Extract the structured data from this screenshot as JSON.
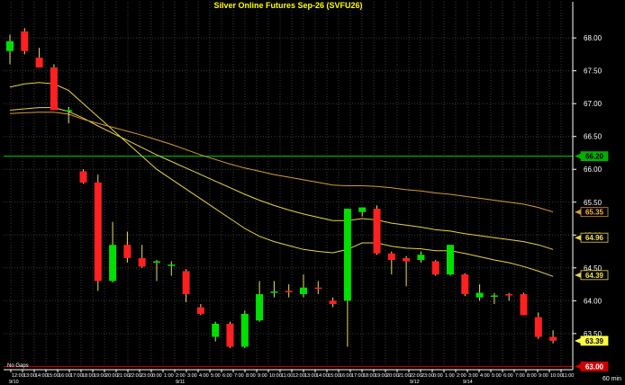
{
  "chart_data": {
    "type": "candlestick",
    "title": "Silver Online Futures  Sep-26  (SVFU26)",
    "interval_label": "60  min",
    "footnote": "No Gaps",
    "ylim": [
      62.95,
      68.55
    ],
    "y_ticks": [
      63.5,
      64.0,
      64.5,
      65.0,
      65.5,
      66.0,
      66.5,
      67.0,
      67.5,
      68.0
    ],
    "y_tick_labels": [
      "63.50",
      "64.00",
      "64.50",
      "65.00",
      "65.50",
      "66.00",
      "66.50",
      "67.00",
      "67.50",
      "68.00"
    ],
    "x_tick_labels": [
      "12:00",
      "13:00",
      "14:00",
      "15:00",
      "16:00",
      "17:00",
      "18:00",
      "19:00",
      "20:00",
      "21:00",
      "22:00",
      "23:00",
      "0:00",
      "1:00",
      "2:00",
      "3:00",
      "4:00",
      "5:00",
      "6:00",
      "7:00",
      "8:00",
      "9:00",
      "10:00",
      "11:00",
      "12:00",
      "13:00",
      "14:00",
      "15:00",
      "16:00",
      "17:00",
      "18:00",
      "19:00",
      "20:00",
      "21:00",
      "22:00",
      "23:00",
      "0:00",
      "1:00",
      "2:00",
      "3:00",
      "4:00",
      "5:00",
      "6:00",
      "7:00",
      "8:00",
      "9:00",
      "10:00",
      "11:00"
    ],
    "date_labels": [
      "9/10",
      "9/11",
      "9/12",
      "9/14"
    ],
    "candles": [
      {
        "o": 67.8,
        "h": 68.05,
        "l": 67.6,
        "c": 67.95
      },
      {
        "o": 68.1,
        "h": 68.15,
        "l": 67.75,
        "c": 67.8
      },
      {
        "o": 67.7,
        "h": 67.85,
        "l": 67.55,
        "c": 67.55
      },
      {
        "o": 67.55,
        "h": 67.6,
        "l": 66.9,
        "c": 66.9
      },
      {
        "o": 66.9,
        "h": 66.95,
        "l": 66.7,
        "c": 66.9
      },
      {
        "o": 65.97,
        "h": 66.0,
        "l": 65.78,
        "c": 65.8
      },
      {
        "o": 65.8,
        "h": 65.92,
        "l": 64.15,
        "c": 64.3
      },
      {
        "o": 64.3,
        "h": 65.2,
        "l": 64.28,
        "c": 64.85
      },
      {
        "o": 64.85,
        "h": 65.05,
        "l": 64.58,
        "c": 64.65
      },
      {
        "o": 64.65,
        "h": 64.85,
        "l": 64.5,
        "c": 64.52
      },
      {
        "o": 64.58,
        "h": 64.62,
        "l": 64.3,
        "c": 64.6
      },
      {
        "o": 64.55,
        "h": 64.6,
        "l": 64.38,
        "c": 64.55
      },
      {
        "o": 64.45,
        "h": 64.48,
        "l": 63.98,
        "c": 64.1
      },
      {
        "o": 63.9,
        "h": 63.95,
        "l": 63.78,
        "c": 63.8
      },
      {
        "o": 63.45,
        "h": 63.68,
        "l": 63.38,
        "c": 63.65
      },
      {
        "o": 63.65,
        "h": 63.68,
        "l": 63.28,
        "c": 63.3
      },
      {
        "o": 63.3,
        "h": 63.85,
        "l": 63.28,
        "c": 63.8
      },
      {
        "o": 63.7,
        "h": 64.3,
        "l": 63.68,
        "c": 64.1
      },
      {
        "o": 64.12,
        "h": 64.3,
        "l": 64.05,
        "c": 64.14
      },
      {
        "o": 64.15,
        "h": 64.25,
        "l": 64.05,
        "c": 64.13
      },
      {
        "o": 64.1,
        "h": 64.4,
        "l": 64.05,
        "c": 64.2
      },
      {
        "o": 64.2,
        "h": 64.3,
        "l": 64.1,
        "c": 64.18
      },
      {
        "o": 64.0,
        "h": 64.05,
        "l": 63.9,
        "c": 63.95
      },
      {
        "o": 64.0,
        "h": 65.4,
        "l": 63.3,
        "c": 65.4
      },
      {
        "o": 65.35,
        "h": 65.42,
        "l": 65.28,
        "c": 65.42
      },
      {
        "o": 65.4,
        "h": 65.45,
        "l": 64.7,
        "c": 64.72
      },
      {
        "o": 64.72,
        "h": 64.75,
        "l": 64.4,
        "c": 64.62
      },
      {
        "o": 64.65,
        "h": 64.68,
        "l": 64.22,
        "c": 64.6
      },
      {
        "o": 64.62,
        "h": 64.75,
        "l": 64.58,
        "c": 64.7
      },
      {
        "o": 64.6,
        "h": 64.62,
        "l": 64.38,
        "c": 64.4
      },
      {
        "o": 64.4,
        "h": 64.85,
        "l": 64.38,
        "c": 64.85
      },
      {
        "o": 64.4,
        "h": 64.42,
        "l": 64.07,
        "c": 64.1
      },
      {
        "o": 64.05,
        "h": 64.25,
        "l": 64.0,
        "c": 64.12
      },
      {
        "o": 64.08,
        "h": 64.12,
        "l": 63.95,
        "c": 64.08
      },
      {
        "o": 64.1,
        "h": 64.12,
        "l": 64.0,
        "c": 64.08
      },
      {
        "o": 64.1,
        "h": 64.12,
        "l": 63.8,
        "c": 63.78
      },
      {
        "o": 63.75,
        "h": 63.82,
        "l": 63.42,
        "c": 63.45
      },
      {
        "o": 63.45,
        "h": 63.55,
        "l": 63.35,
        "c": 63.39
      }
    ],
    "series": [
      {
        "color": "#e8d24a",
        "values": [
          67.25,
          67.3,
          67.32,
          67.3,
          67.2,
          67.0,
          66.8,
          66.6,
          66.4,
          66.2,
          66.0,
          65.85,
          65.7,
          65.55,
          65.4,
          65.25,
          65.1,
          64.98,
          64.9,
          64.84,
          64.78,
          64.75,
          64.73,
          64.78,
          64.88,
          64.88,
          64.83,
          64.8,
          64.79,
          64.76,
          64.76,
          64.72,
          64.67,
          64.62,
          64.58,
          64.52,
          64.45,
          64.37
        ]
      },
      {
        "color": "#e8d24a",
        "values": [
          66.9,
          66.92,
          66.94,
          66.94,
          66.88,
          66.78,
          66.66,
          66.55,
          66.44,
          66.33,
          66.22,
          66.12,
          66.02,
          65.92,
          65.82,
          65.72,
          65.62,
          65.53,
          65.45,
          65.38,
          65.32,
          65.27,
          65.22,
          65.22,
          65.25,
          65.23,
          65.18,
          65.15,
          65.12,
          65.08,
          65.06,
          65.02,
          64.99,
          64.96,
          64.93,
          64.9,
          64.85,
          64.78
        ]
      },
      {
        "color": "#d89a3a",
        "values": [
          66.85,
          66.86,
          66.87,
          66.87,
          66.84,
          66.76,
          66.7,
          66.64,
          66.58,
          66.52,
          66.45,
          66.38,
          66.3,
          66.22,
          66.15,
          66.08,
          66.02,
          65.97,
          65.92,
          65.88,
          65.84,
          65.8,
          65.76,
          65.75,
          65.75,
          65.74,
          65.72,
          65.69,
          65.67,
          65.64,
          65.62,
          65.59,
          65.56,
          65.53,
          65.5,
          65.47,
          65.42,
          65.35
        ]
      }
    ],
    "hlines": [
      {
        "value": 66.2,
        "color": "#00d000",
        "label": "66.20",
        "label_bg": "#00b000",
        "label_fg": "#000000"
      },
      {
        "value": 63.0,
        "color": "#d00000",
        "label": "63.00",
        "label_bg": "#d00000",
        "label_fg": "#ffffff"
      }
    ],
    "price_tags": [
      {
        "value": 65.35,
        "label": "65.35",
        "bg": "#000000",
        "fg": "#ffb84a",
        "border": "#d89a3a"
      },
      {
        "value": 64.96,
        "label": "64.96",
        "bg": "#000000",
        "fg": "#f0e060",
        "border": "#e8d24a"
      },
      {
        "value": 64.39,
        "label": "64.39",
        "bg": "#000000",
        "fg": "#f0e060",
        "border": "#e8d24a"
      },
      {
        "value": 63.39,
        "label": "63.39",
        "bg": "#ffff40",
        "fg": "#000000",
        "border": "#ffff40"
      }
    ],
    "grid": true,
    "colors": {
      "up": "#00e000",
      "down": "#ff2020",
      "grid": "#3a3a3a",
      "axis": "#ffffff",
      "title": "#ffff00",
      "text": "#ffffff"
    }
  }
}
